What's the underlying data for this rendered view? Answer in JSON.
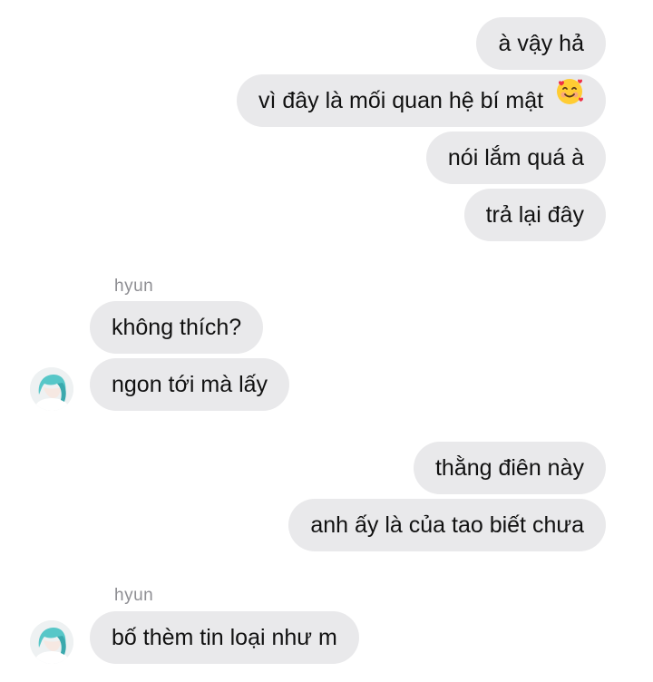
{
  "messages_block_1": {
    "out_1": "à vậy hả",
    "out_2": "vì đây là mối quan hệ bí mật",
    "out_2_emoji": "smiling-face-with-hearts-icon",
    "out_3": "nói lắm quá à",
    "out_4": "trả lại đây"
  },
  "messages_block_2": {
    "sender": "hyun",
    "in_1": "không thích?",
    "in_2": "ngon tới mà lấy"
  },
  "messages_block_3": {
    "out_1": "thằng điên này",
    "out_2": "anh ấy là của tao biết chưa"
  },
  "messages_block_4": {
    "sender": "hyun",
    "in_1": "bố thèm tin loại như m"
  },
  "colors": {
    "bubble": "#e9e9eb",
    "text": "#111111",
    "sender_name": "#8e8e93",
    "background": "#ffffff"
  }
}
